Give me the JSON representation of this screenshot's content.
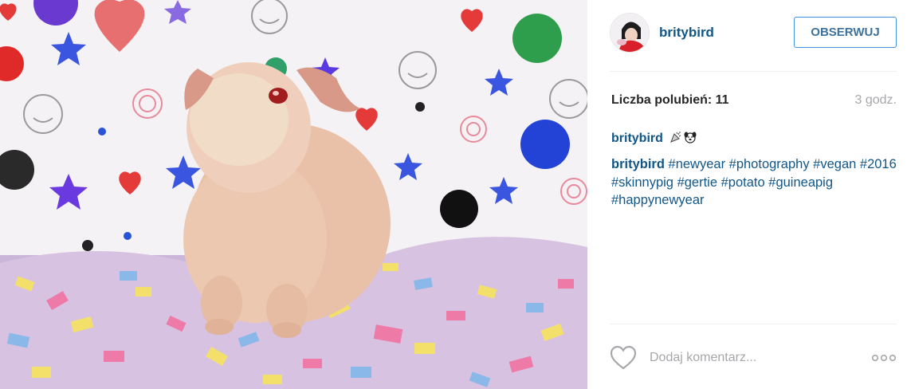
{
  "post": {
    "image_alt": "skinny pig on colorful confetti bedding",
    "author": {
      "username": "britybird",
      "avatar": "user-avatar"
    },
    "follow_label": "OBSERWUJ",
    "likes_label": "Liczba polubień: 11",
    "time_ago": "3 godz.",
    "first_comment": {
      "username": "britybird",
      "emojis": [
        "party-popper-icon",
        "dog-face-icon"
      ]
    },
    "caption": {
      "username": "britybird",
      "tags": [
        "#newyear",
        "#photography",
        "#vegan",
        "#2016",
        "#skinnypig",
        "#gertie",
        "#potato",
        "#guineapig",
        "#happynewyear"
      ]
    },
    "comment_placeholder": "Dodaj komentarz...",
    "icons": {
      "like": "heart-outline-icon",
      "more": "more-options-icon"
    }
  },
  "colors": {
    "link": "#125688",
    "follow_border": "#4090db",
    "follow_text": "#3f729b",
    "muted": "#a5a7aa"
  }
}
